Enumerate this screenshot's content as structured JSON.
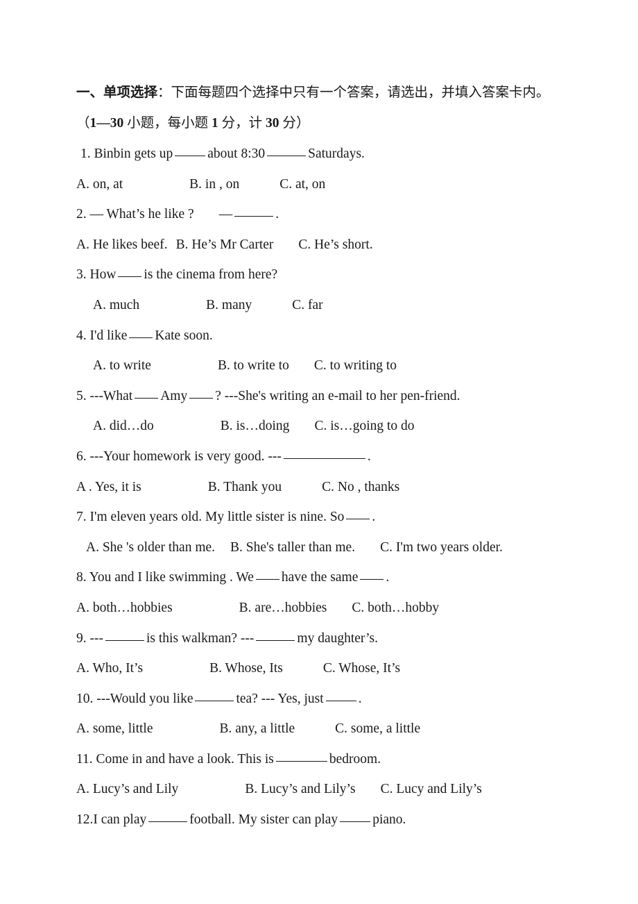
{
  "document": {
    "section_heading": {
      "label_bold": "一、单项选择",
      "rest": "：下面每题四个选择中只有一个答案，请选出，并填入答案卡内。"
    },
    "scoring_note": {
      "open_paren": "（",
      "range_bold": "1—30",
      "mid1": " 小题，每小题 ",
      "points_bold": "1",
      "mid2": " 分，计 ",
      "total_bold": "30",
      "mid3": " 分",
      "close_paren": "）"
    },
    "questions": [
      {
        "number": "1.",
        "stem_parts": [
          "Binbin gets up",
          "about 8:30",
          "Saturdays."
        ],
        "options": [
          "A. on, at",
          "B. in , on",
          "C.  at, on"
        ]
      },
      {
        "number": "2.",
        "stem_parts": [
          "— What’s he like ?",
          "—",
          "."
        ],
        "options": [
          "A. He likes beef.",
          "B. He’s Mr Carter",
          "C. He’s short."
        ]
      },
      {
        "number": "3.",
        "stem_parts": [
          "How",
          "is the cinema from here?"
        ],
        "options": [
          "A. much",
          "B. many",
          "C. far"
        ]
      },
      {
        "number": "4.",
        "stem_parts": [
          "I'd like",
          "Kate soon."
        ],
        "options": [
          "A. to write",
          "B. to write to",
          "C. to writing to"
        ]
      },
      {
        "number": "5.",
        "stem_parts": [
          "---What",
          "Amy",
          "? ---She's writing an e-mail to her pen-friend."
        ],
        "options": [
          "A. did…do",
          "B. is…doing",
          "C. is…going to do"
        ]
      },
      {
        "number": "6.",
        "stem_parts": [
          "---Your homework is very good. ---",
          "."
        ],
        "options": [
          "A . Yes, it is",
          "B. Thank you",
          "C. No , thanks"
        ]
      },
      {
        "number": "7.",
        "stem_parts": [
          "I'm eleven years old. My little sister is nine. So",
          "."
        ],
        "options": [
          "A. She 's older than me.",
          "B. She's taller than me.",
          "C. I'm two years older."
        ]
      },
      {
        "number": "8.",
        "stem_parts": [
          "You and I like swimming . We",
          "have the same",
          "."
        ],
        "options": [
          "A. both…hobbies",
          "B. are…hobbies",
          "C. both…hobby"
        ]
      },
      {
        "number": "9.",
        "stem_parts": [
          "---",
          "is this walkman? ---",
          "my daughter’s."
        ],
        "options": [
          "A. Who, It’s",
          "B. Whose, Its",
          "C. Whose, It’s"
        ]
      },
      {
        "number": "10.",
        "stem_parts": [
          "---Would you like",
          "tea? --- Yes, just",
          "."
        ],
        "options": [
          "A. some, little",
          "B. any, a little",
          "C. some, a little"
        ]
      },
      {
        "number": "11.",
        "stem_parts": [
          "Come in and have a look. This is",
          "bedroom."
        ],
        "options": [
          "A. Lucy’s and Lily",
          "B. Lucy’s and Lily’s",
          "C. Lucy and Lily’s"
        ]
      },
      {
        "number": "12.",
        "stem_parts": [
          "I can play",
          "football. My sister can play",
          "piano."
        ],
        "options": []
      }
    ]
  }
}
